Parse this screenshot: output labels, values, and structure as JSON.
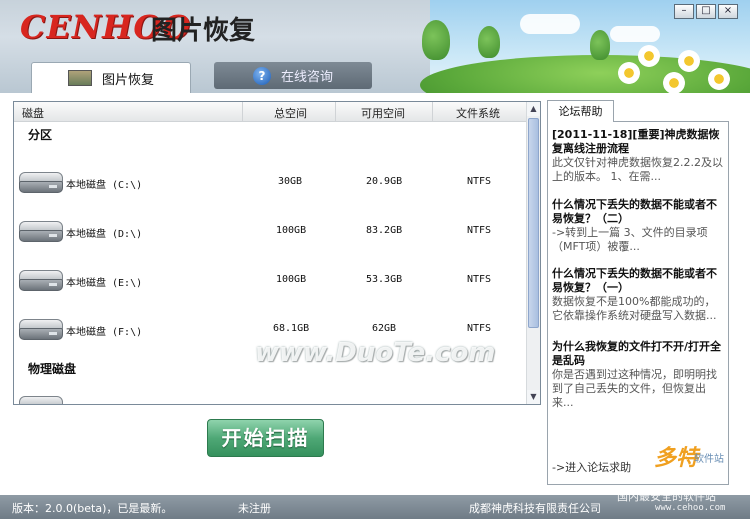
{
  "header": {
    "logo": "CENHOO",
    "title": "图片恢复",
    "window_buttons": [
      "–",
      "□",
      "×"
    ]
  },
  "tabs": [
    {
      "label": "图片恢复",
      "icon": "photo-icon"
    },
    {
      "label": "在线咨询",
      "icon": "help-icon"
    }
  ],
  "drive_table": {
    "columns": [
      "磁盘",
      "总空间",
      "可用空间",
      "文件系统"
    ],
    "sections": [
      "分区",
      "物理磁盘"
    ],
    "rows": [
      {
        "name": "本地磁盘 (C:\\)",
        "total": "30GB",
        "free": "20.9GB",
        "fs": "NTFS"
      },
      {
        "name": "本地磁盘 (D:\\)",
        "total": "100GB",
        "free": "83.2GB",
        "fs": "NTFS"
      },
      {
        "name": "本地磁盘 (E:\\)",
        "total": "100GB",
        "free": "53.3GB",
        "fs": "NTFS"
      },
      {
        "name": "本地磁盘 (F:\\)",
        "total": "68.1GB",
        "free": "62GB",
        "fs": "NTFS"
      }
    ]
  },
  "scan_button": "开始扫描",
  "forum": {
    "tab_label": "论坛帮助",
    "posts": [
      {
        "title": "[2011-11-18][重要]神虎数据恢复离线注册流程",
        "body": "此文仅针对神虎数据恢复2.2.2及以上的版本。  1、在需..."
      },
      {
        "title": "什么情况下丢失的数据不能或者不易恢复？（二）",
        "body": "->转到上一篇 3、文件的目录项（MFT项）被覆..."
      },
      {
        "title": "什么情况下丢失的数据不能或者不易恢复？（一）",
        "body": "数据恢复不是100%都能成功的，它依靠操作系统对硬盘写入数据..."
      },
      {
        "title": "为什么我恢复的文件打不开/打开全是乱码",
        "body": "你是否遇到过这种情况，即明明找到了自己丢失的文件，但恢复出来..."
      }
    ],
    "link": "->进入论坛求助"
  },
  "status": {
    "version": "版本：2.0.0(beta)，已是最新。",
    "registration": "未注册",
    "company": "成都神虎科技有限责任公司"
  },
  "watermarks": {
    "duote": "www.DuoTe.com",
    "brand": "多特",
    "brand_sub": "软件站",
    "slogan": "国内最安全的软件站",
    "url": "www.cehoo.com"
  }
}
